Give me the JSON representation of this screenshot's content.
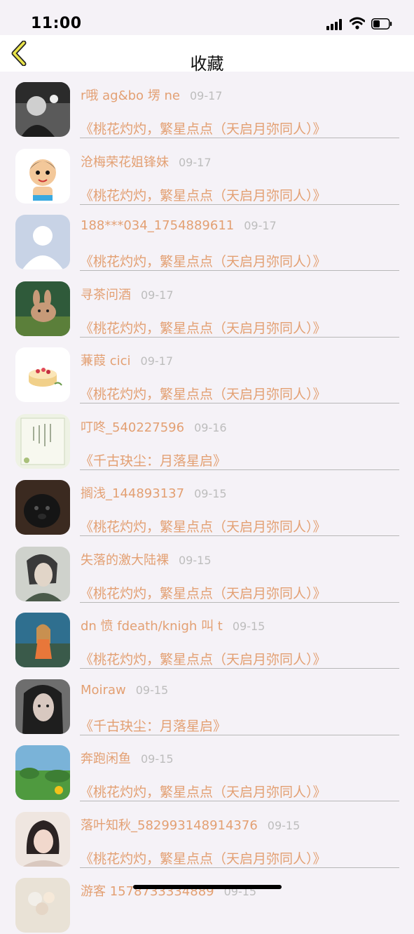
{
  "status_bar": {
    "time": "11:00"
  },
  "nav": {
    "title": "收藏",
    "back_icon": "chevron-left-icon"
  },
  "colors": {
    "accent": "#e3a073",
    "date": "#bdbdbd",
    "background": "#f5f2f7"
  },
  "items": [
    {
      "username": "r哦 ag&bo 塄 ne",
      "date": "09-17",
      "book": "《桃花灼灼，繁星点点（天启月弥同人）》",
      "avatar": "bw-portrait"
    },
    {
      "username": "沧梅荣花姐锋妹",
      "date": "09-17",
      "book": "《桃花灼灼，繁星点点（天启月弥同人）》",
      "avatar": "cartoon-boy"
    },
    {
      "username": "188***034_1754889611",
      "date": "09-17",
      "book": "《桃花灼灼，繁星点点（天启月弥同人）》",
      "avatar": "default-user"
    },
    {
      "username": "寻茶问酒",
      "date": "09-17",
      "book": "《桃花灼灼，繁星点点（天启月弥同人）》",
      "avatar": "cartoon-rabbit"
    },
    {
      "username": "蒹葭 cici",
      "date": "09-17",
      "book": "《桃花灼灼，繁星点点（天启月弥同人）》",
      "avatar": "cake"
    },
    {
      "username": "叮咚_540227596",
      "date": "09-16",
      "book": "《千古玦尘：月落星启》",
      "avatar": "calligraphy"
    },
    {
      "username": "搁浅_144893137",
      "date": "09-15",
      "book": "《桃花灼灼，繁星点点（天启月弥同人）》",
      "avatar": "black-dog"
    },
    {
      "username": "失落的激大陆裸",
      "date": "09-15",
      "book": "《桃花灼灼，繁星点点（天启月弥同人）》",
      "avatar": "gray-portrait"
    },
    {
      "username": "dn 愤 fdeath/knigh 叫 t",
      "date": "09-15",
      "book": "《桃花灼灼，繁星点点（天启月弥同人）》",
      "avatar": "seaside-girl"
    },
    {
      "username": "Moiraw",
      "date": "09-15",
      "book": "《千古玦尘：月落星启》",
      "avatar": "woman-portrait"
    },
    {
      "username": "奔跑闲鱼",
      "date": "09-15",
      "book": "《桃花灼灼，繁星点点（天启月弥同人）》",
      "avatar": "green-field"
    },
    {
      "username": "落叶知秋_582993148914376",
      "date": "09-15",
      "book": "《桃花灼灼，繁星点点（天启月弥同人）》",
      "avatar": "girl-portrait"
    },
    {
      "username": "游客 1578733334889",
      "date": "09-15",
      "book": "",
      "avatar": "flowers"
    }
  ]
}
